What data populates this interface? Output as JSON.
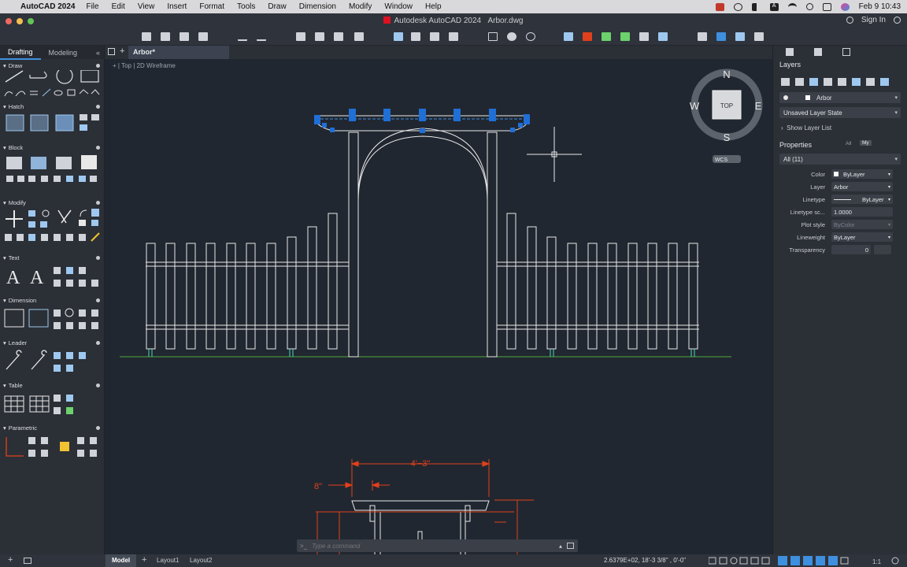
{
  "menubar": {
    "app_name": "AutoCAD 2024",
    "items": [
      "File",
      "Edit",
      "View",
      "Insert",
      "Format",
      "Tools",
      "Draw",
      "Dimension",
      "Modify",
      "Window",
      "Help"
    ],
    "clock": "Feb 9  10:43"
  },
  "titlebar": {
    "app": "Autodesk AutoCAD 2024",
    "file": "Arbor.dwg",
    "signin": "Sign In"
  },
  "left_panel": {
    "tabs": [
      "Drafting",
      "Modeling"
    ],
    "sections": [
      "Draw",
      "Hatch",
      "Block",
      "Modify",
      "Text",
      "Dimension",
      "Leader",
      "Table",
      "Parametric"
    ]
  },
  "document_tab": "Arbor*",
  "viewport": {
    "view": "Top",
    "style": "2D Wireframe",
    "compass": {
      "n": "N",
      "s": "S",
      "e": "E",
      "w": "W",
      "cube": "TOP",
      "ucs": "WCS"
    },
    "dimensions": {
      "width": "4'−3\"",
      "offset": "8\""
    }
  },
  "command_line": {
    "prompt": ">_",
    "placeholder": "Type a command"
  },
  "right_panel": {
    "layers_title": "Layers",
    "layer_current": "Arbor",
    "layer_state": "Unsaved Layer State",
    "show_layer_list": "Show Layer List",
    "properties_title": "Properties",
    "prop_tabs": [
      "All",
      "My"
    ],
    "selection": "All (11)",
    "props": [
      {
        "label": "Color",
        "value": "ByLayer",
        "dim": false
      },
      {
        "label": "Layer",
        "value": "Arbor",
        "dim": false
      },
      {
        "label": "Linetype",
        "value": "ByLayer",
        "dim": false
      },
      {
        "label": "Linetype sc...",
        "value": "1.0000",
        "dim": false
      },
      {
        "label": "Plot style",
        "value": "ByColor",
        "dim": true
      },
      {
        "label": "Lineweight",
        "value": "ByLayer",
        "dim": false
      },
      {
        "label": "Transparency",
        "value": "0",
        "dim": false
      }
    ]
  },
  "status_bar": {
    "tabs": [
      "Model",
      "Layout1",
      "Layout2"
    ],
    "coordinates": "2.6379E+02,  18'-3 3/8\" , 0'-0\"",
    "scale": "1:1"
  },
  "colors": {
    "accent": "#3f8fdf",
    "grip": "#1f6fd6",
    "drawing": "#e8e8e8",
    "dimension": "#e0401c",
    "ground": "#4fa83c"
  }
}
